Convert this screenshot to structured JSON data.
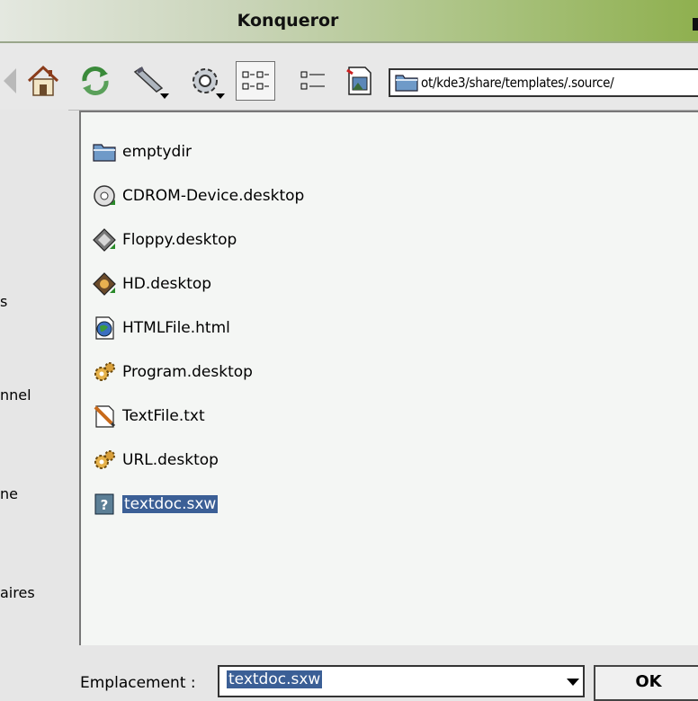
{
  "window": {
    "title": "Konqueror"
  },
  "toolbar": {
    "location_path": "ot/kde3/share/templates/.source/",
    "buttons": [
      "home-icon",
      "reload-icon",
      "tools-icon",
      "settings-gear-icon",
      "icon-view-icon",
      "detail-view-icon",
      "preview-icon"
    ]
  },
  "sidebar": {
    "items": [
      {
        "label": "s"
      },
      {
        "label": "nnel"
      },
      {
        "label": "ne"
      },
      {
        "label": "aires"
      }
    ]
  },
  "files": [
    {
      "name": "emptydir",
      "icon": "folder-icon"
    },
    {
      "name": "CDROM-Device.desktop",
      "icon": "cdrom-icon"
    },
    {
      "name": "Floppy.desktop",
      "icon": "floppy-icon"
    },
    {
      "name": "HD.desktop",
      "icon": "harddisk-icon"
    },
    {
      "name": "HTMLFile.html",
      "icon": "html-file-icon"
    },
    {
      "name": "Program.desktop",
      "icon": "program-gear-icon"
    },
    {
      "name": "TextFile.txt",
      "icon": "text-file-icon"
    },
    {
      "name": "URL.desktop",
      "icon": "url-gear-icon"
    },
    {
      "name": "textdoc.sxw",
      "icon": "unknown-doc-icon",
      "selected": true
    }
  ],
  "bottom": {
    "location_label": "Emplacement :",
    "location_value": "textdoc.sxw",
    "ok_label": "OK"
  },
  "colors": {
    "selection": "#3b5f96",
    "titlebar_accent": "#8fb04f"
  }
}
